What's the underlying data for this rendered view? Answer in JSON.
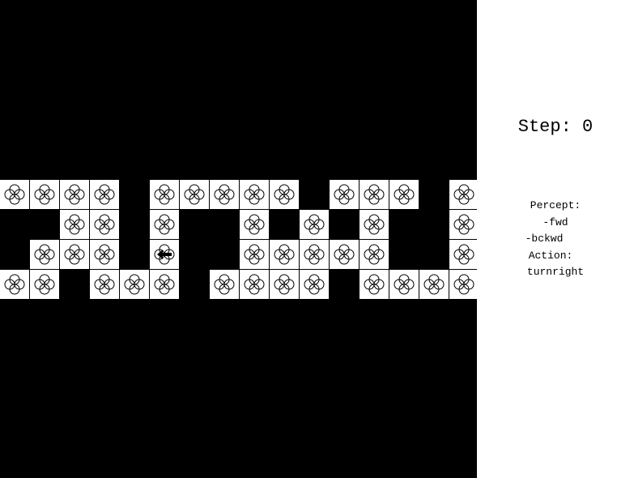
{
  "panel": {
    "step_label": "Step: 0",
    "percept_label": "Percept:",
    "percept_items": [
      "-fwd",
      "-bckwd"
    ],
    "action_label": "Action:",
    "action_value": "turnright"
  },
  "colors": {
    "background": "#000000",
    "tile": "#ffffff",
    "ink": "#000000"
  },
  "grid": {
    "cols": 16,
    "rows": 4,
    "cells": [
      [
        1,
        1,
        1,
        1,
        0,
        1,
        1,
        1,
        1,
        1,
        0,
        1,
        1,
        1,
        0,
        1
      ],
      [
        0,
        0,
        1,
        1,
        0,
        1,
        0,
        0,
        1,
        0,
        1,
        0,
        1,
        0,
        0,
        1
      ],
      [
        0,
        1,
        1,
        1,
        0,
        1,
        0,
        0,
        1,
        1,
        1,
        1,
        1,
        0,
        0,
        1
      ],
      [
        1,
        1,
        0,
        1,
        1,
        1,
        0,
        1,
        1,
        1,
        1,
        0,
        1,
        1,
        1,
        1
      ]
    ],
    "tile_icon": "four-circle-flower-icon"
  },
  "agent": {
    "row": 2,
    "col": 5,
    "heading": "west",
    "icon": "left-arrow-icon"
  }
}
